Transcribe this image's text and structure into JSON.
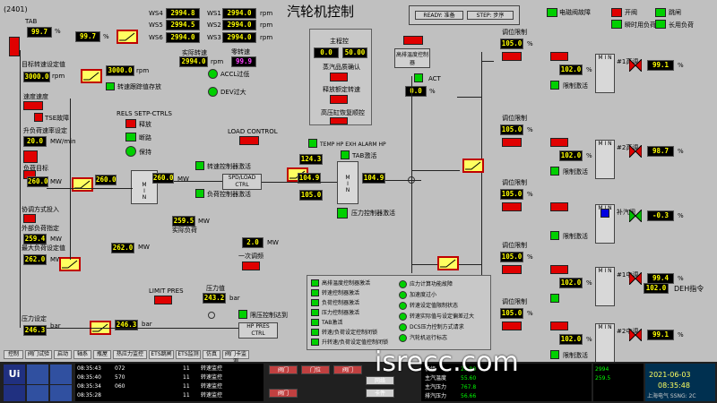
{
  "header": {
    "window_id": "(2401)",
    "title": "汽轮机控制",
    "ready_label": "READY: 准备",
    "step_label": "STEP: 步序"
  },
  "legend": {
    "items": [
      "电磁阀故障",
      "开阀",
      "跳闸",
      "瞬时用负荷",
      "长用负荷"
    ]
  },
  "speed_table": {
    "rows": [
      {
        "label_a": "WS4",
        "value_a": "2994.8",
        "label_b": "WS1",
        "value_b": "2994.0",
        "unit": "rpm"
      },
      {
        "label_a": "WS5",
        "value_a": "2994.5",
        "label_b": "WS2",
        "value_b": "2994.0",
        "unit": "rpm"
      },
      {
        "label_a": "WS6",
        "value_a": "2994.0",
        "label_b": "WS3",
        "value_b": "2994.0",
        "unit": "rpm"
      }
    ]
  },
  "left": {
    "tab_label": "TAB",
    "tab_value": "99.7",
    "tab_value2": "99.7",
    "pct": "%",
    "target_speed_label": "目标转速设定值",
    "target_speed_value": "3000.0",
    "rpm": "rpm",
    "speed_rate_label": "速度速度",
    "speed_rate_value": "3000.0",
    "tse_label": "TSE故障",
    "load_rate_label": "升负荷速率设定",
    "load_rate_value": "20.0",
    "mw_min": "MW/min",
    "load_target_label": "负荷目标",
    "load_target_value": "260.0",
    "mw": "MW",
    "val_260_2": "260.0",
    "val_260_3": "260.0",
    "coord_label": "协调方式投入",
    "external_label": "外部负荷指定",
    "external_value": "259.4",
    "max_load_label": "最大负荷设定值",
    "max_load_value": "262.0",
    "max_load_value2": "262.0",
    "pressure_label": "压力设定",
    "pressure_value": "246.3",
    "pressure_value2": "246.3",
    "bar": "bar",
    "speed_hold_label": "转速跟踪值存放"
  },
  "center": {
    "actual_speed_label": "实际转速",
    "actual_speed_value": "2994.0",
    "zero_speed_label": "零转速",
    "zero_speed_value": "99.9",
    "accl_label": "ACCL过低",
    "dev_label": "DEV过大",
    "rels_label": "RELS SETP-CTRLS",
    "trip1": "释放",
    "trip2": "断路",
    "trip3": "保持",
    "load_control_label": "LOAD CONTROL",
    "spd_load_label": "SPD/LOAD CTRL",
    "speed_ctrl_label": "转速控制器激活",
    "load_ctrl_label": "负荷控制器激活",
    "actual_load_value": "259.5",
    "actual_load_label": "实际负荷",
    "primary_value": "2.0",
    "primary_label": "一次调频",
    "limit_pres_label": "LIMIT PRES",
    "pressure_val_label": "压力值",
    "pressure_val": "243.2",
    "hp_pres_label": "HP PRES CTRL",
    "limit_reached": "限压控制达到"
  },
  "mid": {
    "main_ctrl_label": "主程控",
    "main_ctrl_v1": "0.0",
    "main_ctrl_v2": "50.00",
    "steam_quality": "蒸汽品质确认",
    "release_speed": "释放额定转速",
    "hp_cylinder": "高压缸恢复顺控",
    "temp_alarm": "TEMP HP EXH ALARM HP",
    "tab_active": "TAB激活",
    "v124": "124.3",
    "v104a": "104.9",
    "v104b": "104.9",
    "v105": "105.0",
    "pressure_ctrl_active": "压力控制器激活",
    "hp_temp_ctrl": "高排温度控制器",
    "act_label": "ACT",
    "act_value": "0.0"
  },
  "valves": [
    {
      "name": "调位限制",
      "v1": "105.0",
      "v2": "102.0",
      "tag": "#1高调",
      "out": "99.1",
      "limit": "限制激活"
    },
    {
      "name": "调位限制",
      "v1": "105.0",
      "v2": "102.0",
      "tag": "#2高调",
      "out": "98.7",
      "limit": "限制激活"
    },
    {
      "name": "调位限制",
      "v1": "105.0",
      "v2": "",
      "tag": "补汽阀",
      "out": "-0.3",
      "limit": "限制激活"
    },
    {
      "name": "调位限制",
      "v1": "105.0",
      "v2": "102.0",
      "tag": "#1中调",
      "out": "99.4",
      "limit": ""
    },
    {
      "name": "调位限制",
      "v1": "105.0",
      "v2": "102.0",
      "tag": "#2中调",
      "out": "99.1",
      "limit": "限制激活"
    }
  ],
  "deh": {
    "value": "102.0",
    "label": "DEH指令"
  },
  "status_panel": {
    "left_items": [
      "高排温度控制器激活",
      "转速控制器激活",
      "负荷控制器激活",
      "压力控制器激活",
      "TAB激活",
      "转速/负荷设定控制闭锁",
      "升转速/负荷设定值控制闭锁"
    ],
    "right_items": [
      "应力计算功能故障",
      "加速度过小",
      "转速设定值限制状态",
      "转速实际值与设定偏差过大",
      "DCS压力控制方式请求",
      "汽轮机运行标志"
    ]
  },
  "tabs": [
    "控制",
    "阀门试验",
    "启动",
    "轴系",
    "瓶屋",
    "热应力监控",
    "ETS跳闸",
    "ETS监测",
    "仿真",
    "阀门卡监测"
  ],
  "alarms": [
    {
      "time": "08:35:43",
      "code": "072",
      "ch": "11",
      "text": "转速监控"
    },
    {
      "time": "08:35:40",
      "code": "570",
      "ch": "11",
      "text": "转速监控"
    },
    {
      "time": "08:35:34",
      "code": "060",
      "ch": "11",
      "text": "转速监控"
    },
    {
      "time": "08:35:28",
      "code": "",
      "ch": "11",
      "text": "转速监控"
    }
  ],
  "bottom_buttons": [
    "阀门",
    "门位",
    "阀门",
    "网络",
    "卡件",
    "阀门"
  ],
  "bottom_stats": {
    "rows": [
      {
        "label": "机组",
        "v": "25.80"
      },
      {
        "label": "主汽温度",
        "v": "55.60"
      },
      {
        "label": "主汽压力",
        "v": "767.8"
      },
      {
        "label": "排汽压力",
        "v": "56.66"
      }
    ],
    "speed": "2994",
    "load": "259.5",
    "date": "2021-06-03",
    "time": "08:35:48",
    "footer": "上海电气 SSNG: 2C"
  },
  "watermark": "isrecc.com"
}
